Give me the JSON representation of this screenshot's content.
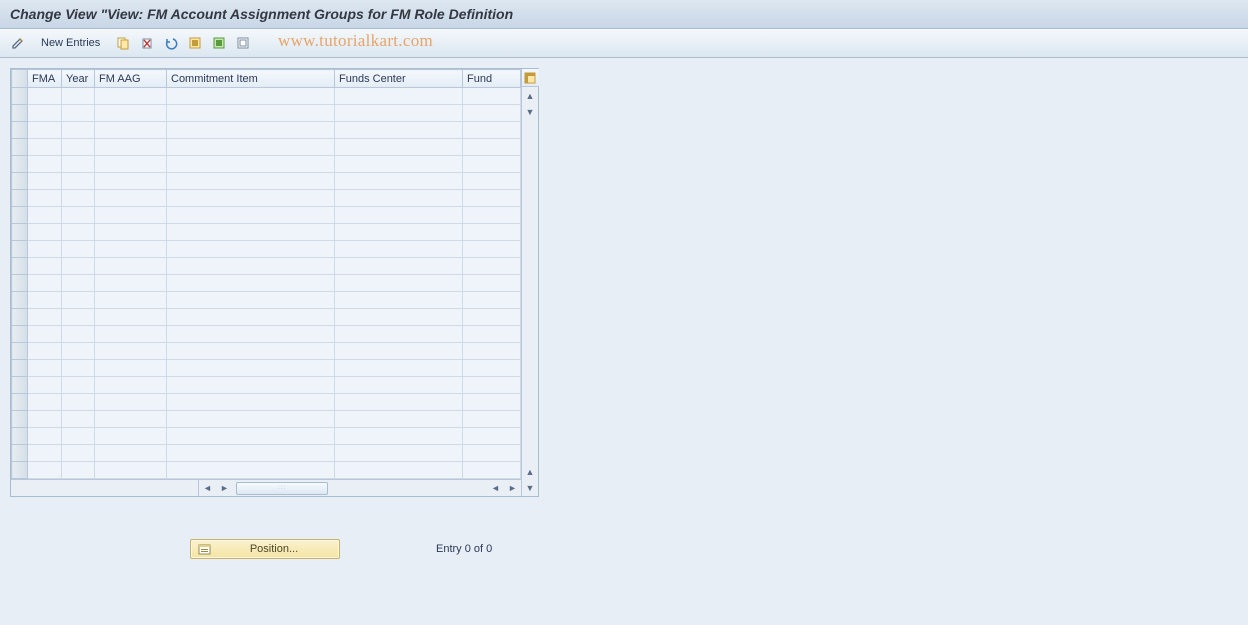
{
  "title": "Change View \"View: FM Account Assignment Groups for FM Role Definition",
  "watermark": "www.tutorialkart.com",
  "toolbar": {
    "new_entries": "New Entries"
  },
  "grid": {
    "columns": [
      "FMA",
      "Year",
      "FM AAG",
      "Commitment Item",
      "Funds Center",
      "Fund"
    ],
    "row_count": 23
  },
  "footer": {
    "position_label": "Position...",
    "entry_text": "Entry 0 of 0"
  }
}
